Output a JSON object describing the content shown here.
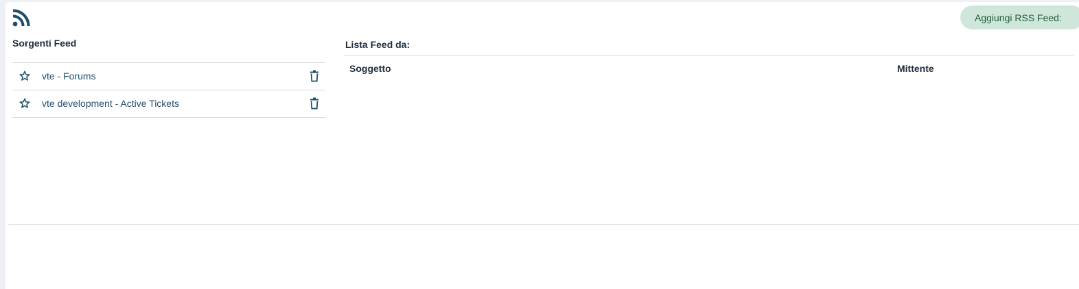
{
  "header": {
    "icon": "rss-icon",
    "add_button_label": "Aggiungi RSS Feed:"
  },
  "sources": {
    "title": "Sorgenti Feed",
    "items": [
      {
        "label": "vte - Forums",
        "star_icon": "star-outline-icon",
        "delete_icon": "trash-icon"
      },
      {
        "label": "vte development - Active Tickets",
        "star_icon": "star-outline-icon",
        "delete_icon": "trash-icon"
      }
    ]
  },
  "feed_list": {
    "title": "Lista Feed da:",
    "columns": [
      "Soggetto",
      "Mittente"
    ],
    "rows": []
  },
  "colors": {
    "accent": "#1b4f6b",
    "button_bg": "#cfe6da",
    "button_text": "#1f5a3c",
    "link": "#25506e"
  }
}
